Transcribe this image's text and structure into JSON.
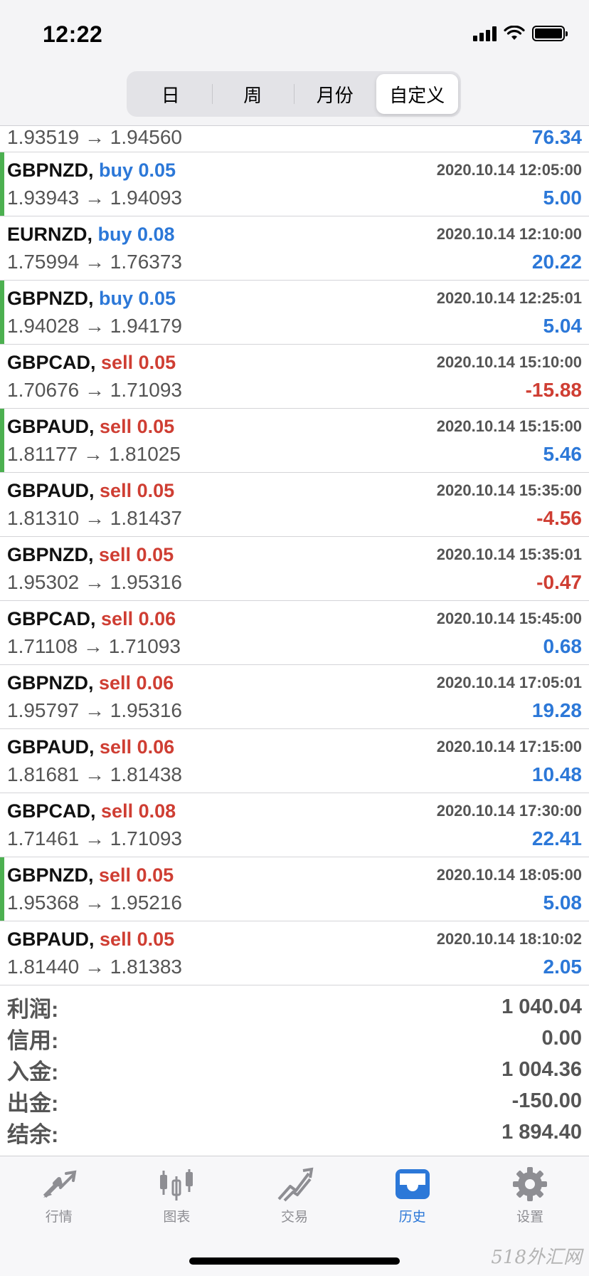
{
  "status_bar": {
    "time": "12:22"
  },
  "period_tabs": [
    {
      "label": "日",
      "active": false
    },
    {
      "label": "周",
      "active": false
    },
    {
      "label": "月份",
      "active": false
    },
    {
      "label": "自定义",
      "active": true
    }
  ],
  "partial_row": {
    "prices": "1.93519 → 1.94560",
    "profit": "76.34"
  },
  "rows": [
    {
      "symbol": "GBPNZD,",
      "direction": "buy 0.05",
      "date": "2020.10.14 12:05:00",
      "prices": "1.93943 → 1.94093",
      "profit": "5.00"
    },
    {
      "symbol": "EURNZD,",
      "direction": "buy 0.08",
      "date": "2020.10.14 12:10:00",
      "prices": "1.75994 → 1.76373",
      "profit": "20.22"
    },
    {
      "symbol": "GBPNZD,",
      "direction": "buy 0.05",
      "date": "2020.10.14 12:25:01",
      "prices": "1.94028 → 1.94179",
      "profit": "5.04"
    },
    {
      "symbol": "GBPCAD,",
      "direction": "sell 0.05",
      "date": "2020.10.14 15:10:00",
      "prices": "1.70676 → 1.71093",
      "profit": "-15.88"
    },
    {
      "symbol": "GBPAUD,",
      "direction": "sell 0.05",
      "date": "2020.10.14 15:15:00",
      "prices": "1.81177 → 1.81025",
      "profit": "5.46"
    },
    {
      "symbol": "GBPAUD,",
      "direction": "sell 0.05",
      "date": "2020.10.14 15:35:00",
      "prices": "1.81310 → 1.81437",
      "profit": "-4.56"
    },
    {
      "symbol": "GBPNZD,",
      "direction": "sell 0.05",
      "date": "2020.10.14 15:35:01",
      "prices": "1.95302 → 1.95316",
      "profit": "-0.47"
    },
    {
      "symbol": "GBPCAD,",
      "direction": "sell 0.06",
      "date": "2020.10.14 15:45:00",
      "prices": "1.71108 → 1.71093",
      "profit": "0.68"
    },
    {
      "symbol": "GBPNZD,",
      "direction": "sell 0.06",
      "date": "2020.10.14 17:05:01",
      "prices": "1.95797 → 1.95316",
      "profit": "19.28"
    },
    {
      "symbol": "GBPAUD,",
      "direction": "sell 0.06",
      "date": "2020.10.14 17:15:00",
      "prices": "1.81681 → 1.81438",
      "profit": "10.48"
    },
    {
      "symbol": "GBPCAD,",
      "direction": "sell 0.08",
      "date": "2020.10.14 17:30:00",
      "prices": "1.71461 → 1.71093",
      "profit": "22.41"
    },
    {
      "symbol": "GBPNZD,",
      "direction": "sell 0.05",
      "date": "2020.10.14 18:05:00",
      "prices": "1.95368 → 1.95216",
      "profit": "5.08"
    },
    {
      "symbol": "GBPAUD,",
      "direction": "sell 0.05",
      "date": "2020.10.14 18:10:02",
      "prices": "1.81440 → 1.81383",
      "profit": "2.05"
    }
  ],
  "summary": [
    {
      "label": "利润:",
      "value": "1 040.04"
    },
    {
      "label": "信用:",
      "value": "0.00"
    },
    {
      "label": "入金:",
      "value": "1 004.36"
    },
    {
      "label": "出金:",
      "value": "-150.00"
    },
    {
      "label": "结余:",
      "value": "1 894.40"
    }
  ],
  "tabbar": [
    {
      "label": "行情",
      "icon": "quotes-arrows-icon",
      "active": false
    },
    {
      "label": "图表",
      "icon": "chart-candles-icon",
      "active": false
    },
    {
      "label": "交易",
      "icon": "trade-trend-icon",
      "active": false
    },
    {
      "label": "历史",
      "icon": "history-tray-icon",
      "active": true
    },
    {
      "label": "设置",
      "icon": "settings-gear-icon",
      "active": false
    }
  ],
  "colors": {
    "buy": "#2c78d8",
    "sell": "#cf3e33",
    "accent": "#2c78d8",
    "marker": "#4cb050"
  },
  "watermark": "518外汇网"
}
